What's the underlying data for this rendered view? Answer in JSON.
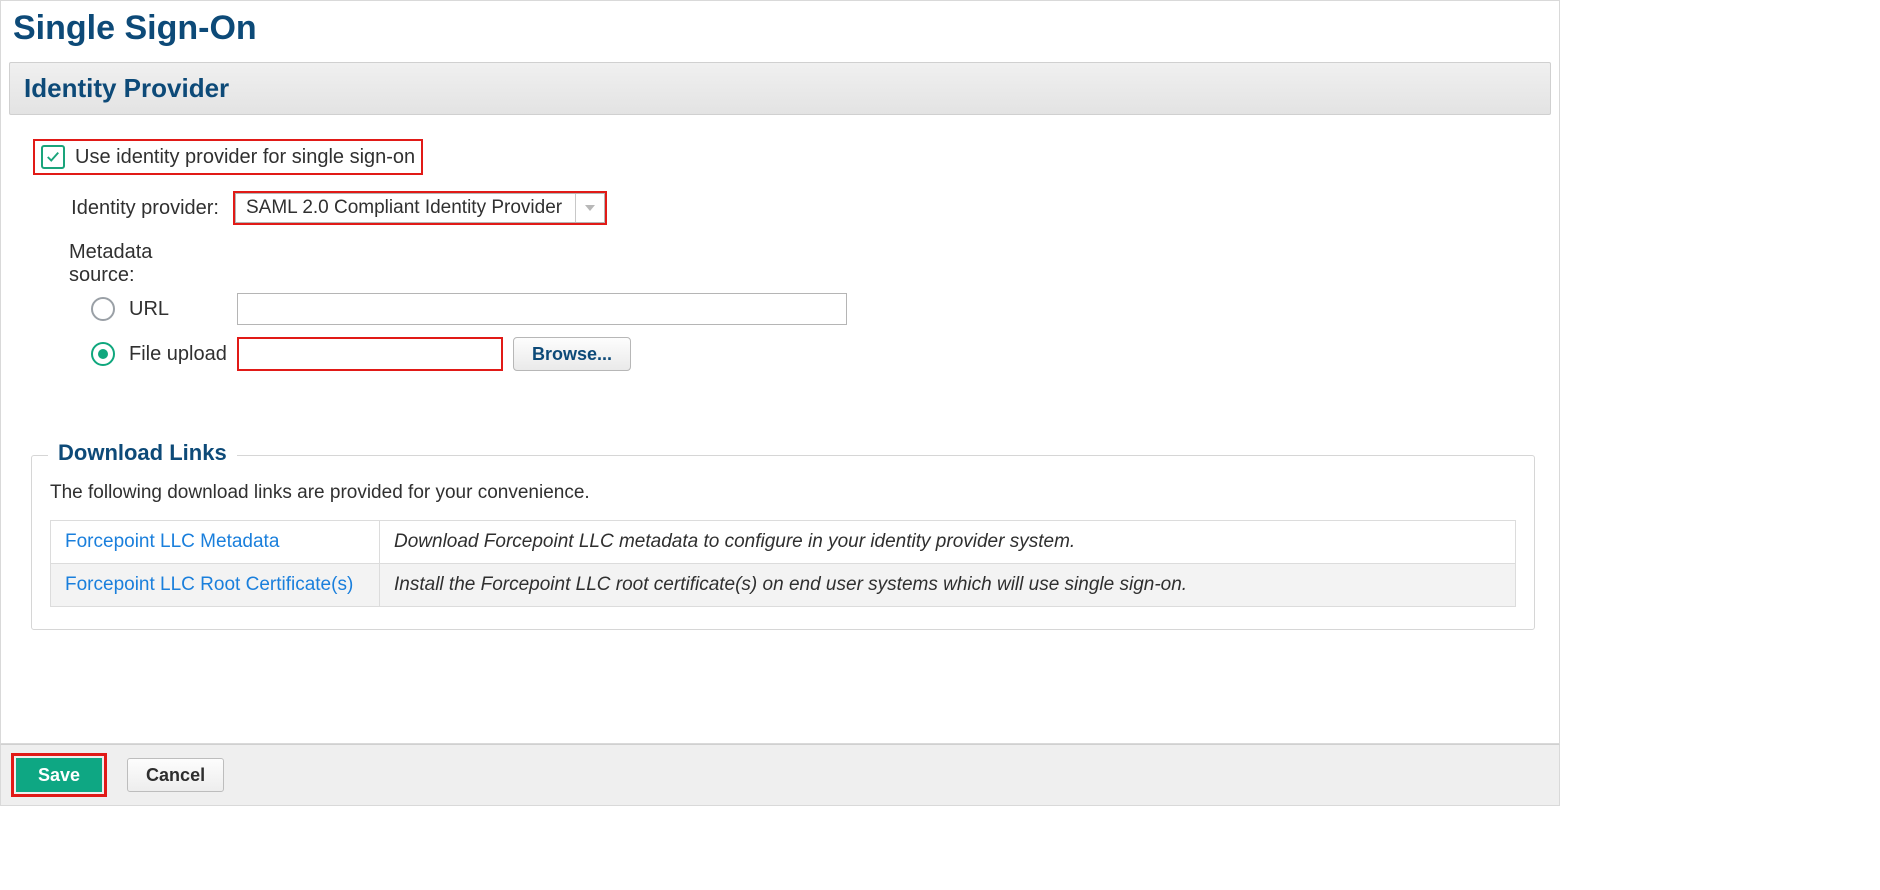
{
  "page": {
    "title": "Single Sign-On"
  },
  "section": {
    "title": "Identity Provider"
  },
  "form": {
    "useIdp": {
      "checked": true,
      "label": "Use identity provider for single sign-on"
    },
    "idpLabel": "Identity provider:",
    "idpSelected": "SAML 2.0 Compliant Identity Provider",
    "metadataLabel": "Metadata source:",
    "urlOption": {
      "label": "URL",
      "value": "",
      "checked": false
    },
    "fileOption": {
      "label": "File upload",
      "value": "",
      "checked": true
    },
    "browseButton": "Browse..."
  },
  "downloads": {
    "legend": "Download Links",
    "desc": "The following download links are provided for your convenience.",
    "rows": [
      {
        "link": "Forcepoint LLC Metadata",
        "desc": "Download Forcepoint LLC metadata to configure in your identity provider system."
      },
      {
        "link": "Forcepoint LLC Root Certificate(s)",
        "desc": "Install the Forcepoint LLC root certificate(s) on end user systems which will use single sign-on."
      }
    ]
  },
  "footer": {
    "save": "Save",
    "cancel": "Cancel"
  }
}
